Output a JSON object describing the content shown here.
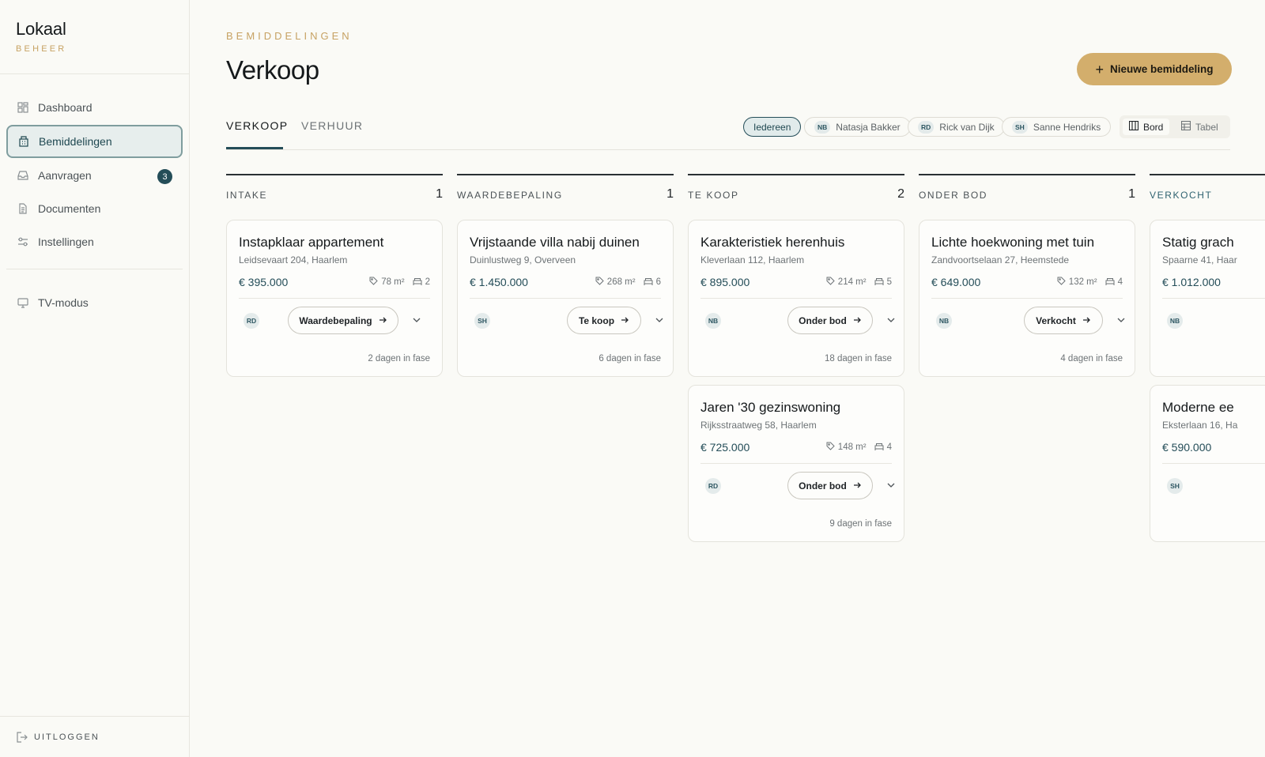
{
  "sidebar": {
    "brand": {
      "name": "Lokaal",
      "sub": "BEHEER"
    },
    "items": [
      {
        "label": "Dashboard",
        "icon": "grid-icon"
      },
      {
        "label": "Bemiddelingen",
        "icon": "building-icon",
        "active": true
      },
      {
        "label": "Aanvragen",
        "icon": "inbox-icon",
        "badge": "3"
      },
      {
        "label": "Documenten",
        "icon": "document-icon"
      },
      {
        "label": "Instellingen",
        "icon": "sliders-icon"
      }
    ],
    "tv": {
      "label": "TV-modus",
      "icon": "monitor-icon"
    },
    "logout": "UITLOGGEN"
  },
  "header": {
    "eyebrow": "BEMIDDELINGEN",
    "title": "Verkoop",
    "primary_action": "Nieuwe bemiddeling"
  },
  "tabs": [
    {
      "label": "VERKOOP",
      "active": true
    },
    {
      "label": "VERHUUR",
      "active": false
    }
  ],
  "filters": [
    {
      "initials": "",
      "label": "Iedereen",
      "active": true
    },
    {
      "initials": "NB",
      "label": "Natasja Bakker"
    },
    {
      "initials": "RD",
      "label": "Rick van Dijk"
    },
    {
      "initials": "SH",
      "label": "Sanne Hendriks"
    }
  ],
  "view_toggle": {
    "board": "Bord",
    "table": "Tabel",
    "active": "board"
  },
  "columns": [
    {
      "title": "INTAKE",
      "count": "1",
      "cards": [
        {
          "title": "Instapklaar appartement",
          "address": "Leidsevaart 204, Haarlem",
          "price": "€ 395.000",
          "area": "78 m²",
          "rooms": "2",
          "agent": "RD",
          "next_stage": "Waardebepaling",
          "days": "2 dagen in fase"
        }
      ]
    },
    {
      "title": "WAARDEBEPALING",
      "count": "1",
      "cards": [
        {
          "title": "Vrijstaande villa nabij duinen",
          "address": "Duinlustweg 9, Overveen",
          "price": "€ 1.450.000",
          "area": "268 m²",
          "rooms": "6",
          "agent": "SH",
          "next_stage": "Te koop",
          "days": "6 dagen in fase"
        }
      ]
    },
    {
      "title": "TE KOOP",
      "count": "2",
      "cards": [
        {
          "title": "Karakteristiek herenhuis",
          "address": "Kleverlaan 112, Haarlem",
          "price": "€ 895.000",
          "area": "214 m²",
          "rooms": "5",
          "agent": "NB",
          "next_stage": "Onder bod",
          "days": "18 dagen in fase"
        },
        {
          "title": "Jaren '30 gezinswoning",
          "address": "Rijksstraatweg 58, Haarlem",
          "price": "€ 725.000",
          "area": "148 m²",
          "rooms": "4",
          "agent": "RD",
          "next_stage": "Onder bod",
          "days": "9 dagen in fase"
        }
      ]
    },
    {
      "title": "ONDER BOD",
      "count": "1",
      "cards": [
        {
          "title": "Lichte hoekwoning met tuin",
          "address": "Zandvoortselaan 27, Heemstede",
          "price": "€ 649.000",
          "area": "132 m²",
          "rooms": "4",
          "agent": "NB",
          "next_stage": "Verkocht",
          "days": "4 dagen in fase"
        }
      ]
    },
    {
      "title": "VERKOCHT",
      "count": "",
      "cards": [
        {
          "title": "Statig grach",
          "address": "Spaarne 41, Haar",
          "price": "€ 1.012.000",
          "agent": "NB"
        },
        {
          "title": "Moderne ee",
          "address": "Eksterlaan 16, Ha",
          "price": "€ 590.000",
          "agent": "SH"
        }
      ]
    }
  ],
  "colors": {
    "accent": "#d3ae6c",
    "primary": "#244d58",
    "background": "#fafaf6"
  }
}
